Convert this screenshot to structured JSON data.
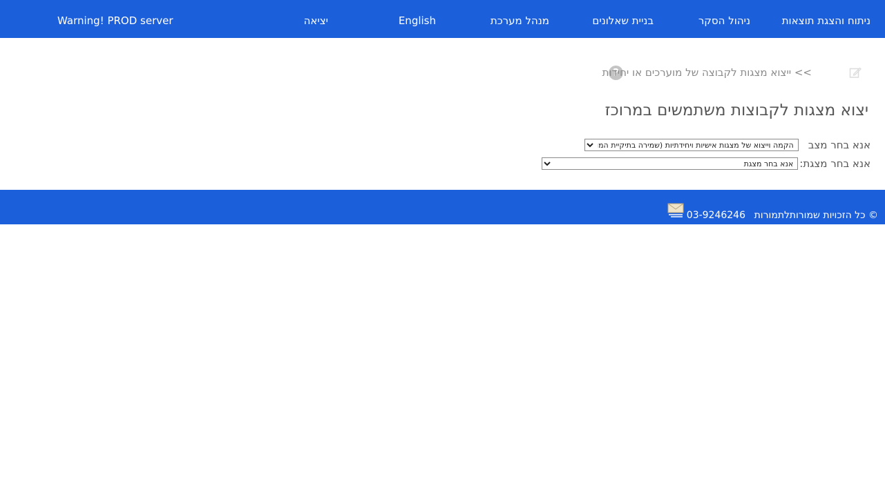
{
  "header": {
    "nav": [
      {
        "label": "ניתוח והצגת תוצאות"
      },
      {
        "label": "ניהול הסקר"
      },
      {
        "label": "בניית שאלונים"
      },
      {
        "label": "מנהל מערכת"
      },
      {
        "label": "English"
      },
      {
        "label": "יציאה"
      }
    ],
    "warning": "Warning! PROD server"
  },
  "breadcrumb": {
    "text": ">> ייצוא מצגות לקבוצה של מוערכים או יחידות",
    "help_icon": "question-circle-icon",
    "edit_icon": "edit-icon"
  },
  "page_title": "יצוא מצגות לקבוצות משתמשים במרוכז",
  "form": {
    "mode_label": "אנא בחר מצב",
    "mode_selected": "הקמה וייצוא של מצגות אישיות ויחידתיות (שמירה בתיקיית המוערך)",
    "display_label": "אנא בחר מצגת:",
    "display_selected": "אנא בחר מצגת"
  },
  "footer": {
    "copyright": "© כל הזכויות שמורות",
    "support_label": "לתמורות",
    "phone": "03-9246246",
    "mail_icon": "envelope-icon"
  },
  "colors": {
    "brand_blue": "#1c5fdb",
    "text_gray": "#555555",
    "muted_gray": "#8a8a8a"
  }
}
